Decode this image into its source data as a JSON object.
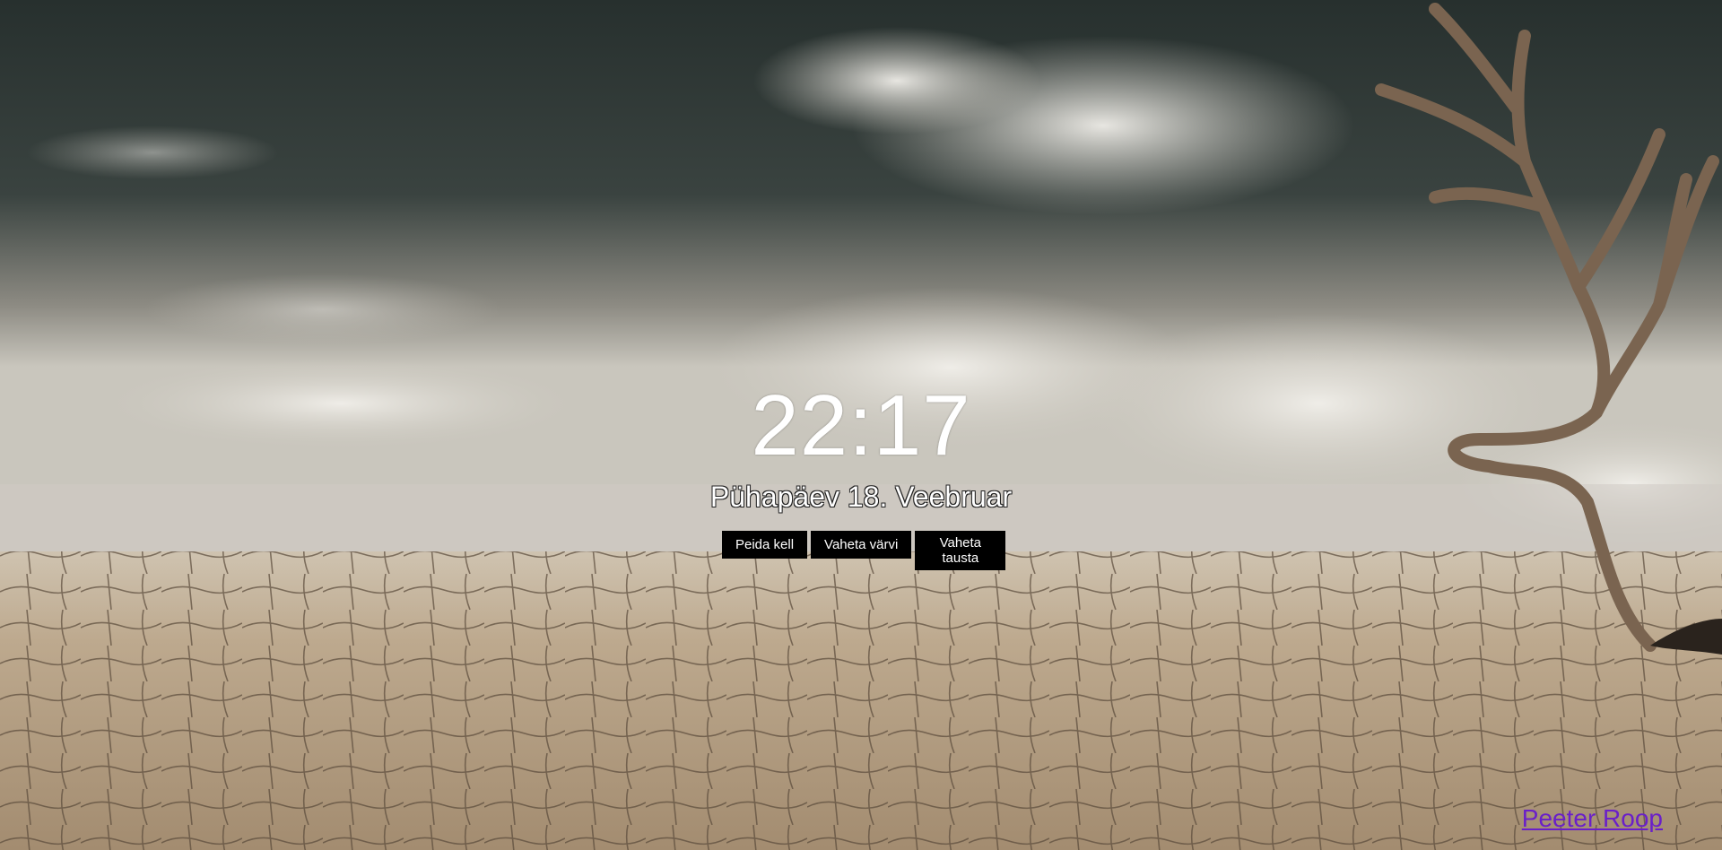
{
  "clock": {
    "time": "22:17",
    "date": "Pühapäev 18. Veebruar"
  },
  "controls": {
    "hide_clock_label": "Peida kell",
    "change_color_label": "Vaheta värvi",
    "change_background_label": "Vaheta tausta"
  },
  "footer": {
    "author_link_text": "Peeter Roop"
  },
  "background": {
    "description_icon": "desert-landscape-with-dead-tree",
    "sky_color_dark": "#2e3633",
    "cloud_color": "#d9d6cf",
    "ground_color": "#b9a58a",
    "crack_color": "#5a4a3a",
    "tree_color": "#7a6450"
  },
  "colors": {
    "clock_text": "#ffffff",
    "button_background": "#000000",
    "button_text": "#ffffff",
    "link": "#6a1fc9"
  }
}
